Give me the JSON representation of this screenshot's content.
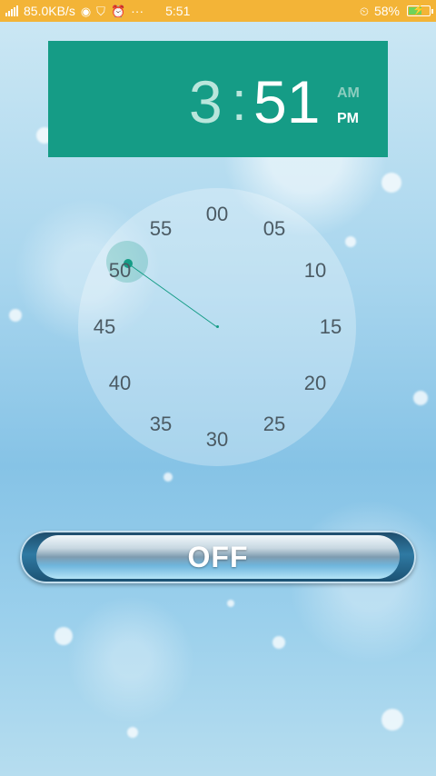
{
  "status_bar": {
    "network_speed": "85.0KB/s",
    "time": "5:51",
    "battery_percent": "58%",
    "dots": "···",
    "colors": {
      "background": "#f3b437"
    },
    "icons": [
      "signal-icon",
      "app-icon",
      "shield-icon",
      "alarm-clock-icon",
      "alarm-icon",
      "battery-icon"
    ]
  },
  "time_display": {
    "hour": "3",
    "separator": ":",
    "minute": "51",
    "am_label": "AM",
    "pm_label": "PM",
    "selected_period": "PM",
    "colors": {
      "header": "#159c86"
    }
  },
  "clock": {
    "numbers": [
      "00",
      "05",
      "10",
      "15",
      "20",
      "25",
      "30",
      "35",
      "40",
      "45",
      "50",
      "55"
    ],
    "selected": "50"
  },
  "off_button": {
    "label": "OFF"
  }
}
